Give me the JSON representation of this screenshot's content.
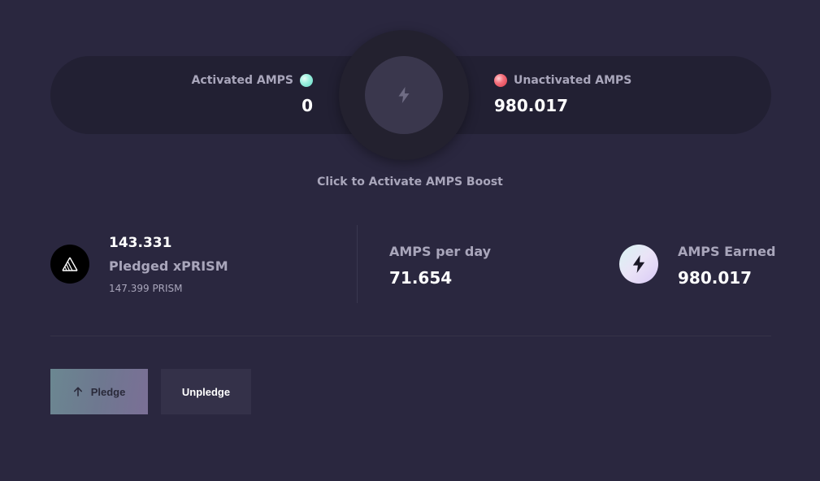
{
  "boost": {
    "activated_label": "Activated AMPS",
    "activated_value": "0",
    "unactivated_label": "Unactivated AMPS",
    "unactivated_value": "980.017",
    "hint": "Click to Activate AMPS Boost",
    "activated_dot_color": "#9ff1df",
    "unactivated_dot_color": "#f5707c"
  },
  "stats": {
    "pledged_amount": "143.331",
    "pledged_label": "Pledged xPRISM",
    "prism_sub": "147.399 PRISM",
    "per_day_label": "AMPS per day",
    "per_day_value": "71.654",
    "earned_label": "AMPS Earned",
    "earned_value": "980.017"
  },
  "actions": {
    "pledge_label": "Pledge",
    "unpledge_label": "Unpledge"
  },
  "icons": {
    "activate": "lightning-icon",
    "prism_logo": "prism-logo-icon",
    "amps_logo": "lightning-icon",
    "pledge": "arrow-up-icon"
  },
  "colors": {
    "background": "#2a273f",
    "panel": "#222033",
    "pledge_button": "#6e7890",
    "unpledge_button": "#343149"
  }
}
